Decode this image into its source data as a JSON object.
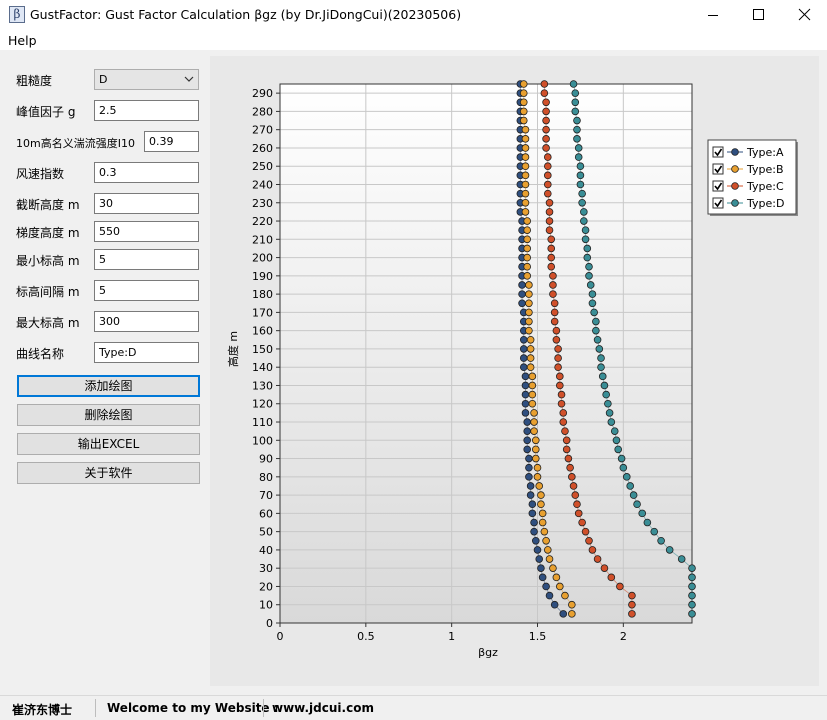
{
  "window": {
    "icon_glyph": "β",
    "title": "GustFactor: Gust Factor Calculation βgz (by Dr.JiDongCui)(20230506)",
    "controls": [
      "minimize-icon",
      "maximize-icon",
      "close-icon"
    ]
  },
  "menu": {
    "help": "Help"
  },
  "form": {
    "roughness": {
      "label": "粗糙度",
      "value": "D"
    },
    "peak_factor": {
      "label": "峰值因子 g",
      "value": "2.5"
    },
    "turbulence": {
      "label": "10m高名义湍流强度I10",
      "value": "0.39"
    },
    "wind_exp": {
      "label": "风速指数",
      "value": "0.3"
    },
    "cutoff_height": {
      "label": "截断高度 m",
      "value": "30"
    },
    "gradient_height": {
      "label": "梯度高度 m",
      "value": "550"
    },
    "min_height": {
      "label": "最小标高 m",
      "value": "5"
    },
    "height_step": {
      "label": "标高间隔 m",
      "value": "5"
    },
    "max_height": {
      "label": "最大标高 m",
      "value": "300"
    },
    "curve_name": {
      "label": "曲线名称",
      "value": "Type:D"
    }
  },
  "buttons": {
    "add_plot": "添加绘图",
    "delete_plot": "删除绘图",
    "export_excel": "输出EXCEL",
    "about": "关于软件"
  },
  "status": {
    "author": "崔济东博士",
    "welcome": "Welcome to my Website :",
    "website": "www.jdcui.com"
  },
  "chart_data": {
    "type": "scatter",
    "xlabel": "βgz",
    "ylabel": "高度 m",
    "xlim": [
      0,
      2.4
    ],
    "ylim": [
      0,
      295
    ],
    "x_ticks": [
      0,
      0.5,
      1,
      1.5,
      2
    ],
    "y_ticks": [
      0,
      10,
      20,
      30,
      40,
      50,
      60,
      70,
      80,
      90,
      100,
      110,
      120,
      130,
      140,
      150,
      160,
      170,
      180,
      190,
      200,
      210,
      220,
      230,
      240,
      250,
      260,
      270,
      280,
      290
    ],
    "grid": true,
    "legend_position": "top-right",
    "heights": [
      5,
      10,
      15,
      20,
      25,
      30,
      35,
      40,
      45,
      50,
      55,
      60,
      65,
      70,
      75,
      80,
      85,
      90,
      95,
      100,
      105,
      110,
      115,
      120,
      125,
      130,
      135,
      140,
      145,
      150,
      155,
      160,
      165,
      170,
      175,
      180,
      185,
      190,
      195,
      200,
      205,
      210,
      215,
      220,
      225,
      230,
      235,
      240,
      245,
      250,
      255,
      260,
      265,
      270,
      275,
      280,
      285,
      290,
      295
    ],
    "series": [
      {
        "name": "Type:A",
        "color": "#2f4f7f",
        "values": [
          1.65,
          1.6,
          1.57,
          1.55,
          1.53,
          1.52,
          1.51,
          1.5,
          1.49,
          1.48,
          1.48,
          1.47,
          1.47,
          1.46,
          1.46,
          1.45,
          1.45,
          1.45,
          1.44,
          1.44,
          1.44,
          1.44,
          1.43,
          1.43,
          1.43,
          1.43,
          1.43,
          1.42,
          1.42,
          1.42,
          1.42,
          1.42,
          1.42,
          1.42,
          1.41,
          1.41,
          1.41,
          1.41,
          1.41,
          1.41,
          1.41,
          1.41,
          1.41,
          1.41,
          1.4,
          1.4,
          1.4,
          1.4,
          1.4,
          1.4,
          1.4,
          1.4,
          1.4,
          1.4,
          1.4,
          1.4,
          1.4,
          1.4,
          1.4
        ]
      },
      {
        "name": "Type:B",
        "color": "#e8a030",
        "values": [
          1.7,
          1.7,
          1.66,
          1.63,
          1.61,
          1.59,
          1.57,
          1.56,
          1.55,
          1.54,
          1.53,
          1.53,
          1.52,
          1.52,
          1.51,
          1.5,
          1.5,
          1.49,
          1.49,
          1.49,
          1.48,
          1.48,
          1.48,
          1.47,
          1.47,
          1.47,
          1.47,
          1.46,
          1.46,
          1.46,
          1.46,
          1.45,
          1.45,
          1.45,
          1.45,
          1.45,
          1.45,
          1.44,
          1.44,
          1.44,
          1.44,
          1.44,
          1.44,
          1.44,
          1.43,
          1.43,
          1.43,
          1.43,
          1.43,
          1.43,
          1.43,
          1.43,
          1.43,
          1.43,
          1.42,
          1.42,
          1.42,
          1.42,
          1.42
        ]
      },
      {
        "name": "Type:C",
        "color": "#d0502a",
        "values": [
          2.05,
          2.05,
          2.05,
          1.98,
          1.93,
          1.89,
          1.85,
          1.82,
          1.8,
          1.78,
          1.76,
          1.74,
          1.73,
          1.72,
          1.71,
          1.7,
          1.69,
          1.68,
          1.67,
          1.67,
          1.66,
          1.65,
          1.65,
          1.64,
          1.64,
          1.63,
          1.63,
          1.62,
          1.62,
          1.62,
          1.61,
          1.61,
          1.6,
          1.6,
          1.6,
          1.59,
          1.59,
          1.59,
          1.58,
          1.58,
          1.58,
          1.58,
          1.57,
          1.57,
          1.57,
          1.57,
          1.56,
          1.56,
          1.56,
          1.56,
          1.56,
          1.55,
          1.55,
          1.55,
          1.55,
          1.55,
          1.55,
          1.54,
          1.54
        ]
      },
      {
        "name": "Type:D",
        "color": "#3a8e96",
        "values": [
          2.4,
          2.4,
          2.4,
          2.4,
          2.4,
          2.4,
          2.34,
          2.27,
          2.22,
          2.18,
          2.14,
          2.11,
          2.08,
          2.06,
          2.04,
          2.02,
          2.0,
          1.99,
          1.97,
          1.96,
          1.95,
          1.93,
          1.92,
          1.91,
          1.9,
          1.89,
          1.88,
          1.87,
          1.87,
          1.86,
          1.85,
          1.84,
          1.84,
          1.83,
          1.82,
          1.82,
          1.81,
          1.8,
          1.8,
          1.79,
          1.79,
          1.78,
          1.78,
          1.77,
          1.77,
          1.76,
          1.76,
          1.75,
          1.75,
          1.75,
          1.74,
          1.74,
          1.73,
          1.73,
          1.73,
          1.72,
          1.72,
          1.72,
          1.71
        ]
      }
    ]
  }
}
